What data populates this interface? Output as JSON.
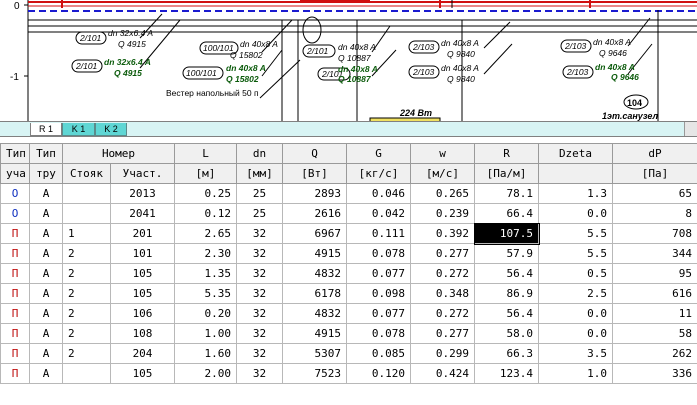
{
  "drawing": {
    "axis_labels": [
      "0",
      "-1"
    ],
    "annotations": {
      "a1": "2/101",
      "a1_dn": "dn 32x6.4 A",
      "a1_q": "Q 4915",
      "a2": "2/101",
      "a2_dn": "dn 32x6.4 A",
      "a2_q": "Q 4915",
      "b1": "100/101",
      "b1_dn": "dn 40x8 A",
      "b1_q": "Q 15802",
      "b2": "100/101",
      "b2_dn": "dn 40x8 A",
      "b2_q": "Q 15802",
      "c1": "2/101",
      "c1_dn": "dn 40x8 A",
      "c1_q": "Q 10887",
      "c2": "2/101",
      "c2_dn": "dn 40x8 A",
      "c2_q": "Q 10887",
      "d1": "2/103",
      "d1_dn": "dn 40x8 A",
      "d1_q": "Q 9840",
      "d2": "2/103",
      "d2_dn": "dn 40x8 A",
      "d2_q": "Q 9840",
      "e1": "2/103",
      "e1_dn": "dn 40x8 A",
      "e1_q": "Q 9646",
      "e2": "2/103",
      "e2_dn": "dn 40x8 A",
      "e2_q": "Q 9646",
      "heater": "Вестер напольный 50 п",
      "power": "224 Вт",
      "room_number": "104",
      "room_name": "1эт.санузел"
    }
  },
  "tabs": [
    {
      "label": "R 1",
      "active": true
    },
    {
      "label": "K 1",
      "active": false
    },
    {
      "label": "K 2",
      "active": false
    }
  ],
  "table": {
    "header1": [
      "Тип",
      "Тип",
      "Номер",
      "L",
      "dn",
      "Q",
      "G",
      "w",
      "R",
      "Dzeta",
      "dP"
    ],
    "header2": [
      "уча",
      "тру",
      "Стояк",
      "Участ.",
      "[м]",
      "[мм]",
      "[Вт]",
      "[кг/с]",
      "[м/с]",
      "[Па/м]",
      "",
      "[Па]"
    ],
    "rows": [
      {
        "type": "О",
        "pipe": "А",
        "riser": "",
        "section": "2013",
        "L": "0.25",
        "dn": "25",
        "Q": "2893",
        "G": "0.046",
        "w": "0.265",
        "R": "78.1",
        "dzeta": "1.3",
        "dP": "65"
      },
      {
        "type": "О",
        "pipe": "А",
        "riser": "",
        "section": "2041",
        "L": "0.12",
        "dn": "25",
        "Q": "2616",
        "G": "0.042",
        "w": "0.239",
        "R": "66.4",
        "dzeta": "0.0",
        "dP": "8"
      },
      {
        "type": "П",
        "pipe": "А",
        "riser": "1",
        "section": "201",
        "L": "2.65",
        "dn": "32",
        "Q": "6967",
        "G": "0.111",
        "w": "0.392",
        "R": "107.5",
        "dzeta": "5.5",
        "dP": "708"
      },
      {
        "type": "П",
        "pipe": "А",
        "riser": "2",
        "section": "101",
        "L": "2.30",
        "dn": "32",
        "Q": "4915",
        "G": "0.078",
        "w": "0.277",
        "R": "57.9",
        "dzeta": "5.5",
        "dP": "344"
      },
      {
        "type": "П",
        "pipe": "А",
        "riser": "2",
        "section": "105",
        "L": "1.35",
        "dn": "32",
        "Q": "4832",
        "G": "0.077",
        "w": "0.272",
        "R": "56.4",
        "dzeta": "0.5",
        "dP": "95"
      },
      {
        "type": "П",
        "pipe": "А",
        "riser": "2",
        "section": "105",
        "L": "5.35",
        "dn": "32",
        "Q": "6178",
        "G": "0.098",
        "w": "0.348",
        "R": "86.9",
        "dzeta": "2.5",
        "dP": "616"
      },
      {
        "type": "П",
        "pipe": "А",
        "riser": "2",
        "section": "106",
        "L": "0.20",
        "dn": "32",
        "Q": "4832",
        "G": "0.077",
        "w": "0.272",
        "R": "56.4",
        "dzeta": "0.0",
        "dP": "11"
      },
      {
        "type": "П",
        "pipe": "А",
        "riser": "2",
        "section": "108",
        "L": "1.00",
        "dn": "32",
        "Q": "4915",
        "G": "0.078",
        "w": "0.277",
        "R": "58.0",
        "dzeta": "0.0",
        "dP": "58"
      },
      {
        "type": "П",
        "pipe": "А",
        "riser": "2",
        "section": "204",
        "L": "1.60",
        "dn": "32",
        "Q": "5307",
        "G": "0.085",
        "w": "0.299",
        "R": "66.3",
        "dzeta": "3.5",
        "dP": "262"
      },
      {
        "type": "П",
        "pipe": "А",
        "riser": "",
        "section": "105",
        "L": "2.00",
        "dn": "32",
        "Q": "7523",
        "G": "0.120",
        "w": "0.424",
        "R": "123.4",
        "dzeta": "1.0",
        "dP": "336"
      }
    ],
    "selected_row": 2,
    "selected_col": "R"
  },
  "colors": {
    "supply_type": "#c01010",
    "return_type": "#1030c0",
    "dashed_line": "#1a1ad0",
    "red_pipe": "#d01010",
    "tab_bar": "#d8f4f4",
    "tab_inactive": "#5fd6d4"
  }
}
